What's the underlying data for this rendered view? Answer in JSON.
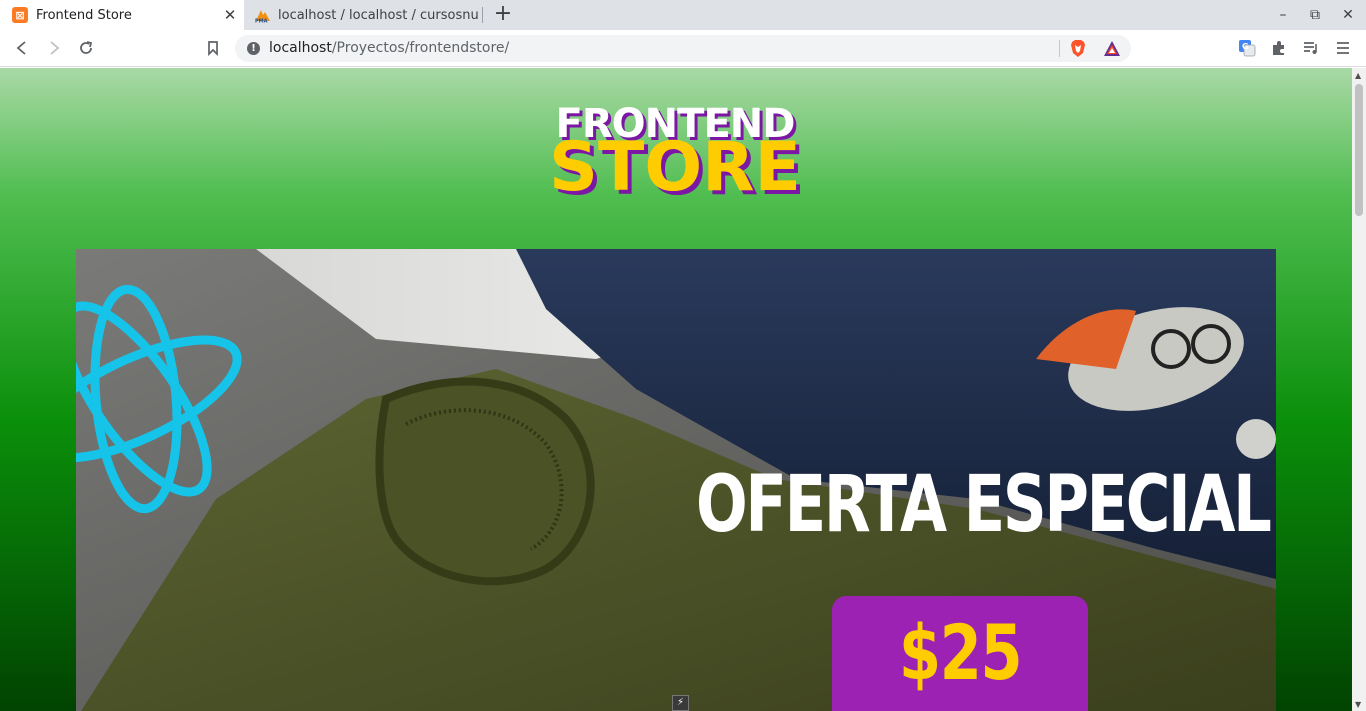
{
  "browser": {
    "tabs": [
      {
        "title": "Frontend Store",
        "active": true,
        "favicon": "xampp-icon"
      },
      {
        "title": "localhost / localhost / cursosnu",
        "active": false,
        "favicon": "phpmyadmin-icon"
      }
    ],
    "favicon_glyph": "⊠",
    "close_glyph": "✕",
    "new_tab_glyph": "+",
    "window_controls": {
      "minimize": "–",
      "restore": "⧉",
      "close": "✕"
    },
    "url": {
      "host": "localhost",
      "path": "/Proyectos/frontendstore/"
    },
    "info_glyph": "!"
  },
  "page": {
    "logo": {
      "line1": "FRONTEND",
      "line2": "STORE"
    },
    "banner": {
      "title": "OFERTA ESPECIAL",
      "price": "$25"
    }
  },
  "colors": {
    "logo_yellow": "#ffcc00",
    "logo_shadow": "#7b16a5",
    "price_box": "#9b22b3",
    "bg_top": "#a9d9a6",
    "bg_bottom": "#014301"
  }
}
